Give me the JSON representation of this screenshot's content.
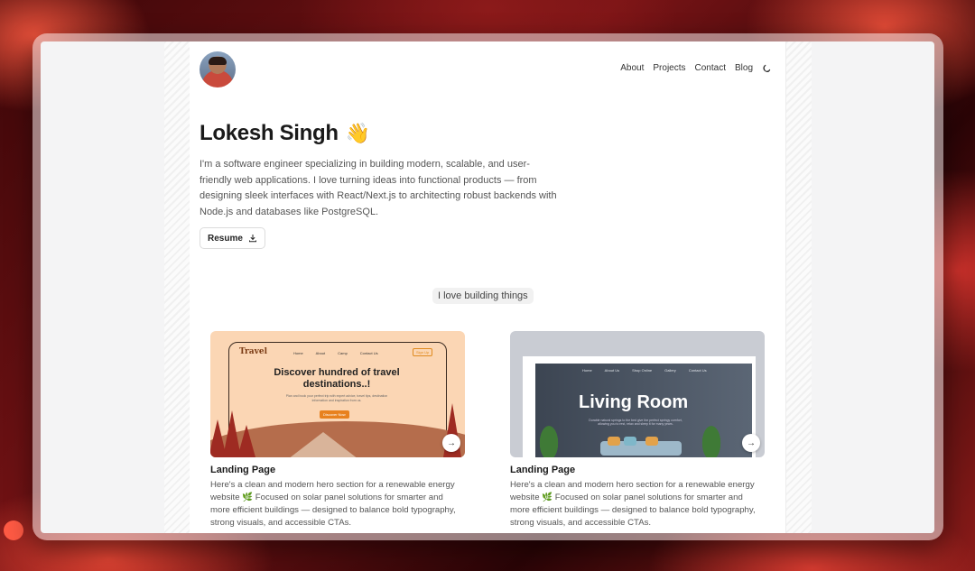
{
  "nav": {
    "items": [
      "About",
      "Projects",
      "Contact",
      "Blog"
    ],
    "theme_icon": "moon-icon"
  },
  "hero": {
    "name": "Lokesh Singh",
    "emoji": "👋",
    "intro": "I'm a software engineer specializing in building modern, scalable, and user-friendly web applications. I love turning ideas into functional products — from designing sleek interfaces with React/Next.js to architecting robust backends with Node.js and databases like PostgreSQL.",
    "resume_label": "Resume",
    "resume_icon": "download-icon"
  },
  "section": {
    "pill": "I love building things"
  },
  "projects": [
    {
      "title": "Landing Page",
      "description": "Here's a clean and modern hero section for a renewable energy website 🌿 Focused on solar panel solutions for smarter and more efficient buildings — designed to balance bold typography, strong visuals, and accessible CTAs.",
      "thumb": {
        "logo": "Travel",
        "nav": [
          "Home",
          "About",
          "Camp",
          "Contact Us"
        ],
        "signup": "Sign Up",
        "headline": "Discover hundred of travel destinations..!",
        "sub": "Plan and book your perfect trip with expert advice, travel tips, destination information and inspiration from us.",
        "cta": "Discover Now"
      }
    },
    {
      "title": "Landing Page",
      "description": "Here's a clean and modern hero section for a renewable energy website 🌿 Focused on solar panel solutions for smarter and more efficient buildings — designed to balance bold typography, strong visuals, and accessible CTAs.",
      "thumb": {
        "nav": [
          "Home",
          "About Us",
          "Shop Online",
          "Gallery",
          "Contact Us"
        ],
        "headline": "Living Room",
        "sub": "Durable natural springs to the bed give the perfect springy comfort, allowing you to rest, relax and sleep it for many years."
      }
    }
  ],
  "colors": {
    "accent_orange": "#e8811e",
    "text_dark": "#1a1a1a"
  }
}
